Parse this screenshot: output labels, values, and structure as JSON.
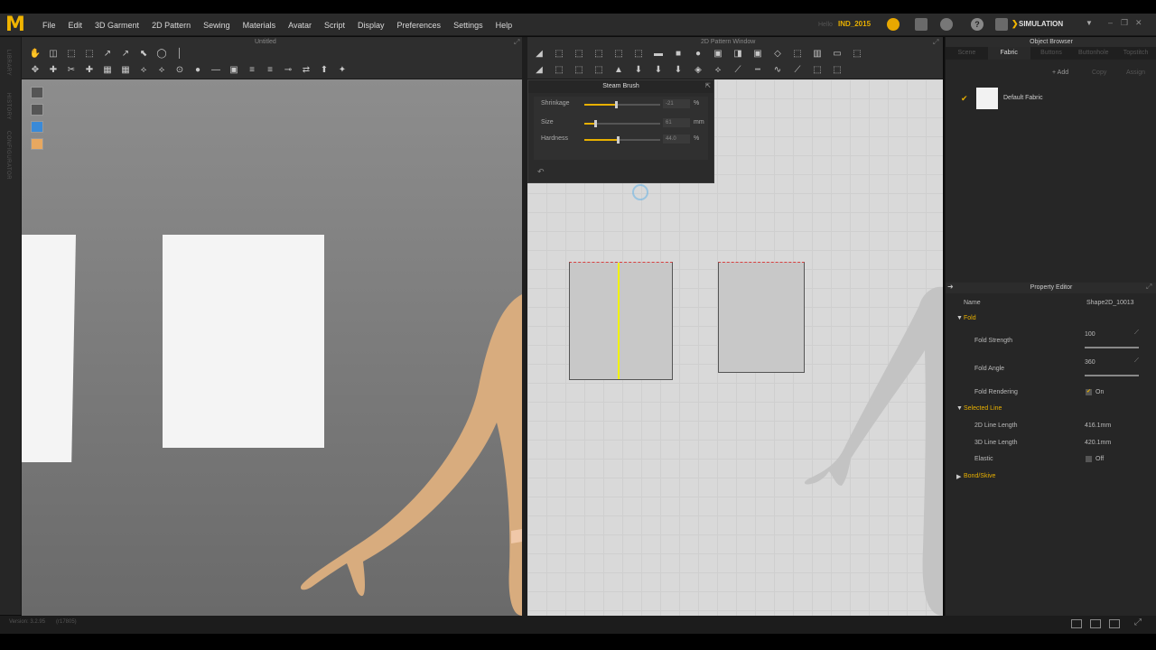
{
  "menu": {
    "logo": "M",
    "items": [
      "File",
      "Edit",
      "3D Garment",
      "2D Pattern",
      "Sewing",
      "Materials",
      "Avatar",
      "Script",
      "Display",
      "Preferences",
      "Settings",
      "Help"
    ],
    "hello": "Hello",
    "username": "IND_2015",
    "simulation_label": "SIMULATION"
  },
  "sidebar": {
    "tabs": [
      "LIBRARY",
      "HISTORY",
      "CONFIGURATOR"
    ]
  },
  "panel3d": {
    "title": "Untitled"
  },
  "panel2d": {
    "title": "2D Pattern Window"
  },
  "steam_brush": {
    "title": "Steam Brush",
    "rows": [
      {
        "label": "Shrinkage",
        "value": "-21",
        "unit": "%",
        "fill": 0.42
      },
      {
        "label": "Size",
        "value": "61",
        "unit": "mm",
        "fill": 0.14
      },
      {
        "label": "Hardness",
        "value": "44.0",
        "unit": "%",
        "fill": 0.44
      }
    ]
  },
  "object_browser": {
    "title": "Object Browser",
    "tabs": [
      "Scene",
      "Fabric",
      "Buttons",
      "Buttonhole",
      "Topstitch"
    ],
    "active_tab": "Fabric",
    "actions": [
      "+ Add",
      "Copy",
      "Assign"
    ],
    "fabric_name": "Default Fabric"
  },
  "property_editor": {
    "title": "Property Editor",
    "name_label": "Name",
    "name_value": "Shape2D_10013",
    "fold_section": "Fold",
    "fold_strength_label": "Fold Strength",
    "fold_strength_value": "100",
    "fold_angle_label": "Fold Angle",
    "fold_angle_value": "360",
    "fold_rendering_label": "Fold Rendering",
    "fold_rendering_value": "On",
    "selected_line_section": "Selected Line",
    "line2d_label": "2D Line Length",
    "line2d_value": "416.1mm",
    "line3d_label": "3D Line Length",
    "line3d_value": "420.1mm",
    "elastic_label": "Elastic",
    "elastic_value": "Off",
    "bond_section": "Bond/Skive"
  },
  "status": {
    "version": "Version: 3.2.95",
    "build": "(r17805)"
  },
  "colors": {
    "accent": "#e8b000",
    "selected_line": "#f2f200",
    "seam_red": "#d84040"
  }
}
